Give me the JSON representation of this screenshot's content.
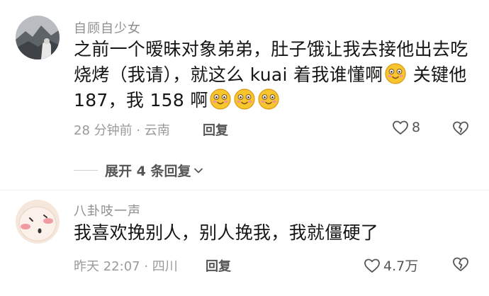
{
  "comments": [
    {
      "username": "自顾自少女",
      "text_line1": "之前一个暧昧对象弟弟，肚子饿让我去接他出去吃",
      "text_line2_a": "烧烤（我请），就这么 kuai 着我谁懂啊",
      "text_line2_b": "  关键他",
      "text_line3": "187，我 158 啊",
      "emoji_name": "blush-smile-emoji",
      "time": "28 分钟前 · 云南",
      "reply_label": "回复",
      "like_count": "8"
    },
    {
      "username": "八卦吱一声",
      "text_line1": "我喜欢挽别人，别人挽我，我就僵硬了",
      "time": "昨天 22:07 · 四川",
      "reply_label": "回复",
      "like_count": "4.7万"
    }
  ],
  "expand_label": "展开 4 条回复",
  "icons": {
    "like": "heart-outline-icon",
    "dislike": "broken-heart-icon",
    "expand": "chevron-down-icon"
  }
}
